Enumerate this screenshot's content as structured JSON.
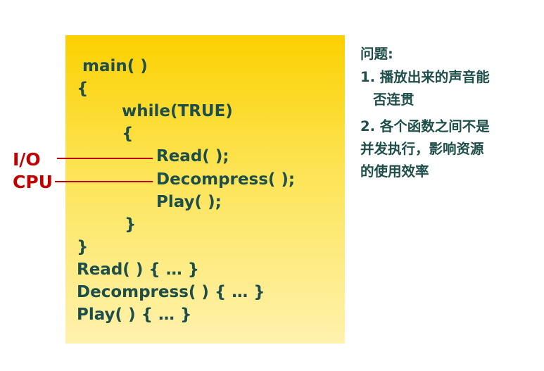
{
  "code": {
    "lines": [
      "main( )",
      "{",
      "while(TRUE)",
      "{",
      "Read( );",
      "Decompress( );",
      "Play( );",
      "}",
      "}",
      "Read( ) { … }",
      "Decompress( ) { … }",
      "Play( ) { … }"
    ]
  },
  "labels": {
    "io": "I/O",
    "cpu": "CPU"
  },
  "notes": {
    "title": "问题:",
    "items": [
      {
        "lines": [
          "1. 播放出来的声音能",
          "否连贯"
        ]
      },
      {
        "lines": [
          "2. 各个函数之间不是",
          "并发执行，影响资源",
          "的使用效率"
        ]
      }
    ]
  },
  "colors": {
    "code_text": "#1e4e4a",
    "label_red": "#c00000",
    "panel_top": "#fcd000",
    "panel_bottom": "#fef2ad"
  }
}
